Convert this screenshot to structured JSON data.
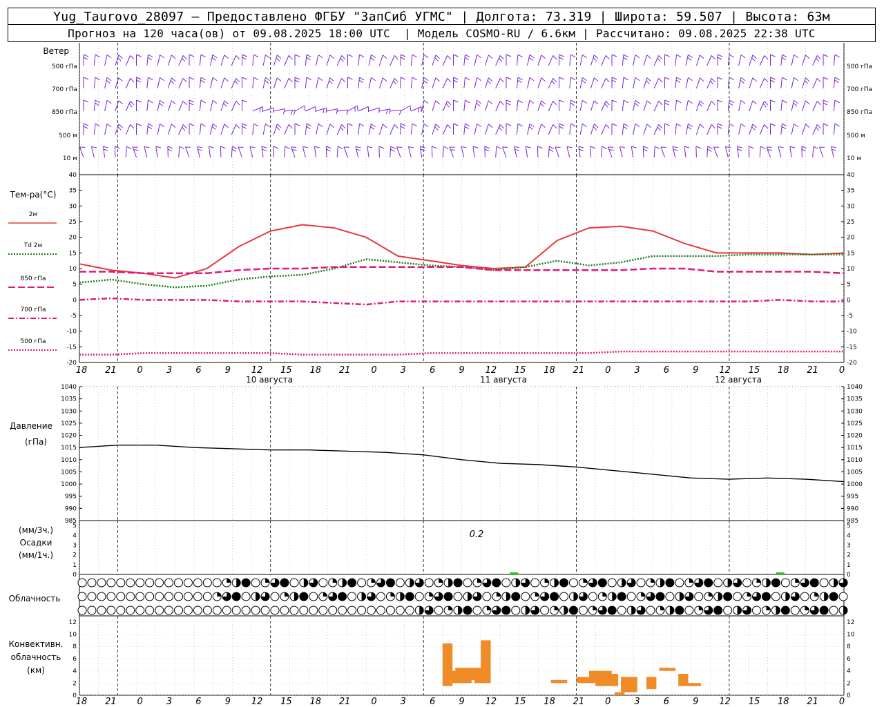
{
  "header": {
    "line1": "Yug_Taurovo_28097 – Предоставлено ФГБУ \"ЗапСиб УГМС\" | Долгота: 73.319 | Широта: 59.507 | Высота: 63м",
    "line2": "Прогноз на 120 часа(ов) от 09.08.2025 18:00 UTC  | Модель COSMO-RU / 6.6км | Рассчитано: 09.08.2025 22:38 UTC"
  },
  "colors": {
    "wind": "#7a1fd6",
    "t2m": "#e8383a",
    "td2m": "#1a7a14",
    "t850": "#e0187a",
    "t700": "#e0187a",
    "t500": "#e0187a",
    "pressure": "#000000",
    "precip": "#22cc22",
    "convective": "#f08c28"
  },
  "wind_panel": {
    "title": "Ветер",
    "levels": [
      "500 гПа",
      "700 гПа",
      "850 гПа",
      "500 м",
      "10  м"
    ]
  },
  "temp_panel": {
    "title": "Тем-ра(°С)",
    "legend": [
      "2м",
      "Td  2м",
      "850 гПа",
      "700 гПа",
      "500 гПа"
    ],
    "yticks": [
      40,
      35,
      30,
      25,
      20,
      15,
      10,
      5,
      0,
      -5,
      -10,
      -15,
      -20
    ]
  },
  "pressure_panel": {
    "title": "Давление",
    "unit": "(гПа)",
    "yticks": [
      1040,
      1035,
      1030,
      1025,
      1020,
      1015,
      1010,
      1005,
      1000,
      995,
      990,
      985
    ]
  },
  "precip_panel": {
    "unit_top": "(мм/3ч.)",
    "title": "Осадки",
    "unit_bottom": "(мм/1ч.)",
    "yticks": [
      5,
      4,
      3,
      2,
      1,
      0
    ],
    "annotation": "0.2"
  },
  "cloud_panel": {
    "title": "Облачность"
  },
  "conv_panel": {
    "title_lines": [
      "Конвективн.",
      "облачность",
      "(км)"
    ],
    "yticks": [
      12,
      10,
      8,
      6,
      4,
      2,
      0
    ]
  },
  "time_axis": {
    "hour_labels": [
      "18",
      "21",
      "0",
      "3",
      "6",
      "9",
      "12",
      "15",
      "18",
      "21",
      "0",
      "3",
      "6",
      "9",
      "12",
      "15",
      "18",
      "21",
      "0",
      "3",
      "6",
      "9",
      "12",
      "15",
      "18",
      "21",
      "0"
    ],
    "day_labels": [
      "10 августа",
      "11 августа",
      "12 августа"
    ]
  },
  "chart_data": [
    {
      "type": "line",
      "name": "temperature",
      "x_hours_from_start": [
        0,
        3,
        6,
        9,
        12,
        15,
        18,
        21,
        24,
        27,
        30,
        33,
        36,
        39,
        42,
        45,
        48,
        51,
        54,
        57,
        60,
        63,
        66,
        69,
        72
      ],
      "series": [
        {
          "name": "2м",
          "values": [
            11.5,
            9.5,
            8.5,
            7.0,
            10.0,
            17.0,
            22.0,
            24.0,
            23.0,
            20.0,
            14.0,
            12.5,
            11.0,
            10.0,
            10.5,
            19.0,
            23.0,
            23.5,
            22.0,
            18.0,
            15.0,
            15.0,
            15.0,
            14.5,
            15.0
          ]
        },
        {
          "name": "Td 2м",
          "values": [
            5.5,
            6.5,
            5.0,
            4.0,
            4.5,
            6.5,
            7.5,
            8.0,
            10.0,
            13.0,
            12.0,
            11.0,
            10.5,
            9.5,
            10.5,
            12.5,
            11.0,
            12.0,
            14.0,
            14.0,
            14.0,
            14.5,
            14.5,
            14.5,
            14.5
          ]
        },
        {
          "name": "850 гПа",
          "values": [
            9.0,
            9.0,
            8.5,
            8.5,
            8.5,
            9.5,
            10.0,
            10.0,
            10.5,
            10.5,
            10.5,
            10.5,
            10.5,
            9.5,
            9.5,
            9.5,
            9.5,
            9.5,
            10.0,
            10.0,
            9.0,
            9.0,
            9.0,
            9.0,
            8.5
          ]
        },
        {
          "name": "700 гПа",
          "values": [
            0.0,
            0.5,
            0.0,
            0.0,
            0.0,
            -0.5,
            -0.5,
            -0.5,
            -1.0,
            -1.5,
            -0.5,
            -0.5,
            -0.5,
            -0.5,
            -0.5,
            -0.5,
            -0.5,
            -0.5,
            -0.5,
            -0.5,
            -0.5,
            -0.5,
            0.0,
            -0.5,
            -0.5
          ]
        },
        {
          "name": "500 гПа",
          "values": [
            -17.5,
            -17.5,
            -17.0,
            -17.0,
            -17.0,
            -17.0,
            -17.0,
            -17.5,
            -17.5,
            -17.5,
            -17.5,
            -17.0,
            -17.0,
            -17.0,
            -17.0,
            -17.0,
            -17.0,
            -16.5,
            -16.5,
            -16.5,
            -16.5,
            -16.5,
            -16.5,
            -16.5,
            -16.5
          ]
        }
      ],
      "ylim": [
        -20,
        40
      ]
    },
    {
      "type": "line",
      "name": "pressure",
      "x_hours_from_start": [
        0,
        6,
        12,
        18,
        24,
        30,
        36,
        42,
        48,
        54,
        60,
        66,
        72,
        78,
        84,
        90,
        96,
        102,
        108,
        114,
        120
      ],
      "series": [
        {
          "name": "pressure",
          "values": [
            1015,
            1016,
            1016,
            1015,
            1014.5,
            1014,
            1014,
            1013.5,
            1013,
            1012,
            1010,
            1008.5,
            1008,
            1007,
            1005.5,
            1004,
            1002.5,
            1002,
            1002.5,
            1002,
            1001
          ]
        }
      ],
      "ylim": [
        985,
        1040
      ]
    },
    {
      "type": "bar",
      "name": "precipitation",
      "x_hours_from_start": [
        62,
        110
      ],
      "values": [
        0.2,
        0.05
      ],
      "ylim": [
        0,
        5
      ]
    },
    {
      "type": "bar",
      "name": "convective_cloud",
      "bars": [
        {
          "x": 57,
          "base": 1.5,
          "top": 8.5
        },
        {
          "x": 58,
          "base": 2.0,
          "top": 4.0
        },
        {
          "x": 59,
          "base": 2.0,
          "top": 4.5
        },
        {
          "x": 60,
          "base": 2.0,
          "top": 4.5
        },
        {
          "x": 61,
          "base": 2.5,
          "top": 4.5
        },
        {
          "x": 62,
          "base": 2.0,
          "top": 4.5
        },
        {
          "x": 63,
          "base": 2.0,
          "top": 9.0
        },
        {
          "x": 74,
          "base": 2.0,
          "top": 2.5
        },
        {
          "x": 75,
          "base": 2.0,
          "top": 2.5
        },
        {
          "x": 78,
          "base": 2.0,
          "top": 3.0
        },
        {
          "x": 79,
          "base": 2.0,
          "top": 3.0
        },
        {
          "x": 80,
          "base": 2.0,
          "top": 4.0
        },
        {
          "x": 81,
          "base": 1.5,
          "top": 4.0
        },
        {
          "x": 82,
          "base": 1.5,
          "top": 4.0
        },
        {
          "x": 83,
          "base": 1.5,
          "top": 3.5
        },
        {
          "x": 84,
          "base": 0.0,
          "top": 0.5
        },
        {
          "x": 85,
          "base": 0.5,
          "top": 3.0
        },
        {
          "x": 86,
          "base": 0.5,
          "top": 3.0
        },
        {
          "x": 89,
          "base": 1.0,
          "top": 3.0
        },
        {
          "x": 91,
          "base": 4.0,
          "top": 4.5
        },
        {
          "x": 92,
          "base": 4.0,
          "top": 4.5
        },
        {
          "x": 94,
          "base": 1.5,
          "top": 3.5
        },
        {
          "x": 95,
          "base": 1.5,
          "top": 2.0
        },
        {
          "x": 96,
          "base": 1.5,
          "top": 2.0
        }
      ],
      "ylim": [
        0,
        13
      ]
    }
  ]
}
